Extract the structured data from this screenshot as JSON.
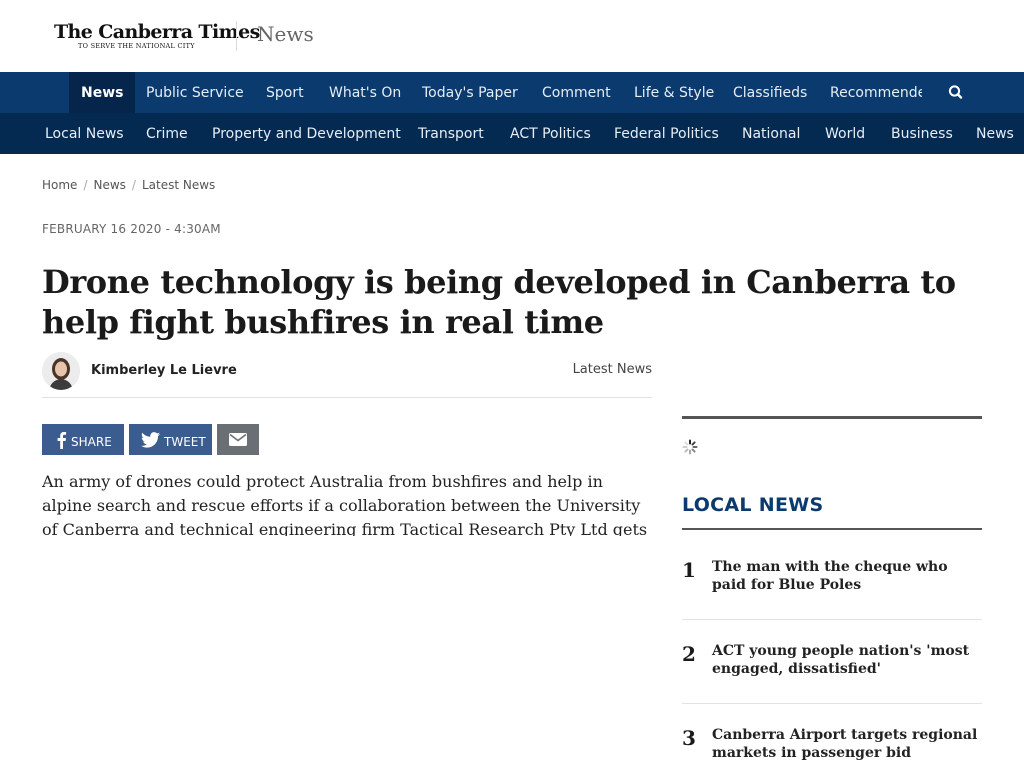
{
  "masthead": {
    "logo_name": "The Canberra Times",
    "logo_tagline": "TO SERVE THE NATIONAL CITY",
    "section": "News"
  },
  "nav_primary": [
    {
      "label": "News",
      "active": true
    },
    {
      "label": "Public Service"
    },
    {
      "label": "Sport"
    },
    {
      "label": "What's On"
    },
    {
      "label": "Today's Paper"
    },
    {
      "label": "Comment"
    },
    {
      "label": "Life & Style"
    },
    {
      "label": "Classifieds"
    },
    {
      "label": "Recommended"
    }
  ],
  "nav_secondary": [
    {
      "label": "Local News"
    },
    {
      "label": "Crime"
    },
    {
      "label": "Property and Development"
    },
    {
      "label": "Transport"
    },
    {
      "label": "ACT Politics"
    },
    {
      "label": "Federal Politics"
    },
    {
      "label": "National"
    },
    {
      "label": "World"
    },
    {
      "label": "Business"
    },
    {
      "label": "News"
    }
  ],
  "breadcrumb": [
    "Home",
    "News",
    "Latest News"
  ],
  "article": {
    "date": "FEBRUARY 16 2020 - 4:30AM",
    "headline": "Drone technology is being developed in Canberra to help fight bushfires in real time",
    "author": "Kimberley Le Lievre",
    "section": "Latest News",
    "body": "An army of drones could protect Australia from bushfires and help in alpine search and rescue efforts if a collaboration between the University of Canberra and technical engineering firm Tactical Research Pty Ltd gets"
  },
  "share": {
    "facebook_label": "SHARE",
    "twitter_label": "TWEET"
  },
  "sidebar": {
    "title": "LOCAL NEWS",
    "items": [
      {
        "num": "1",
        "title": "The man with the cheque who paid for Blue Poles"
      },
      {
        "num": "2",
        "title": "ACT young people nation's 'most engaged, dissatisfied'"
      },
      {
        "num": "3",
        "title": "Canberra Airport targets regional markets in passenger bid"
      }
    ]
  },
  "colors": {
    "nav_primary": "#0a3a6e",
    "nav_secondary": "#052a52",
    "share_blue": "#3a5c8f",
    "share_grey": "#6a6f76"
  }
}
